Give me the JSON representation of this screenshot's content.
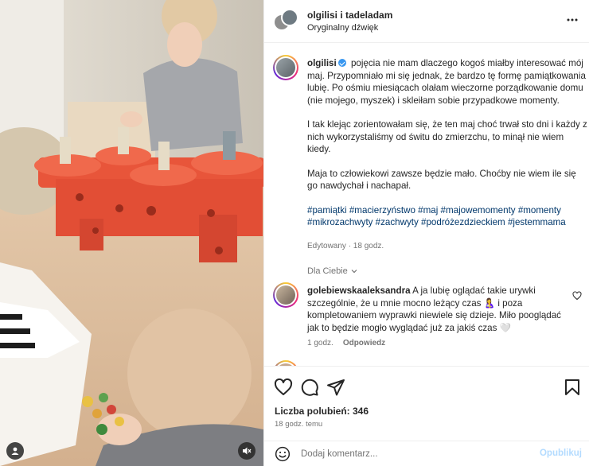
{
  "post": {
    "header": {
      "title": "olgilisi i tadeladam",
      "subtitle": "Oryginalny dźwięk",
      "more_icon": "more-horizontal-icon"
    },
    "caption": {
      "username": "olgilisi",
      "verified": true,
      "paragraph1": "pojęcia nie mam dlaczego kogoś miałby interesować mój maj. Przypomniało mi się jednak, że bardzo tę formę pamiątkowania lubię. Po ośmiu miesiącach olałam wieczorne porządkowanie domu (nie mojego, myszek) i skleiłam sobie przypadkowe momenty.",
      "paragraph2": "I tak klejąc zorientowałam się, że ten maj choć trwał sto dni i każdy z nich wykorzystaliśmy od świtu do zmierzchu, to minął nie wiem kiedy.",
      "paragraph3": "Maja to człowiekowi zawsze będzie mało. Choćby nie wiem ile się go nawdychał i nachapał.",
      "hashtags": "#pamiątki #macierzyństwo #maj #majowemomenty #momenty #mikrozachwyty #zachwyty #podróżezdzieckiem #jestemmama",
      "edited": "Edytowany · 18 godz."
    },
    "for_you_label": "Dla Ciebie",
    "comment": {
      "username": "golebiewskaaleksandra",
      "text_part1": "A ja lubię oglądać takie urywki szczególnie, że u mnie mocno leżący czas",
      "emoji1": "🤱",
      "text_part2": "i poza kompletowaniem wyprawki niewiele się dzieje. Miło pooglądać jak to będzie mogło wyglądać już za jakiś czas",
      "emoji2": "🤍",
      "time": "1 godz.",
      "reply_label": "Odpowiedz"
    },
    "likes_label": "Liczba polubień: 346",
    "time_ago": "18 godz. temu",
    "add_comment": {
      "placeholder": "Dodaj komentarz...",
      "post_label": "Opublikuj"
    },
    "colors": {
      "link": "#00376b",
      "muted": "#737373",
      "post_disabled": "#b3dbff",
      "verified": "#3897f0"
    }
  }
}
